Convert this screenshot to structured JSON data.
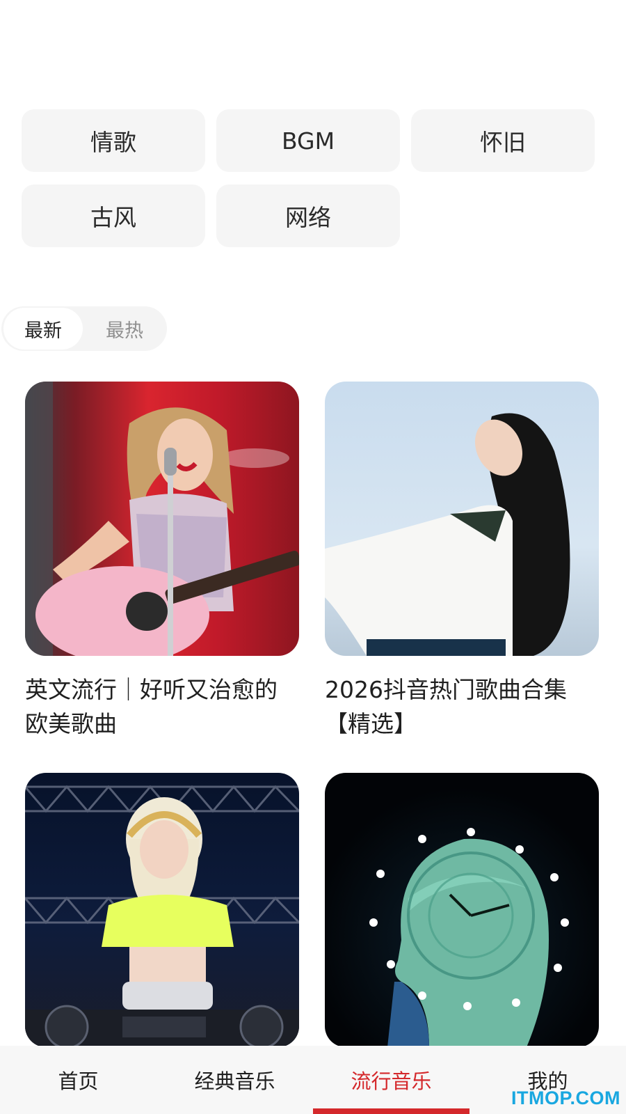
{
  "categories": [
    "情歌",
    "BGM",
    "怀旧",
    "古风",
    "网络"
  ],
  "sort": {
    "newest": "最新",
    "hottest": "最热",
    "selected": "最新"
  },
  "playlists": [
    {
      "title": "英文流行｜好听又治愈的\n欧美歌曲",
      "cover_icon": "guitar-singer-cover"
    },
    {
      "title": "2026抖音热门歌曲合集\n【精选】",
      "cover_icon": "girl-sky-cover"
    },
    {
      "title": "",
      "cover_icon": "dj-cover"
    },
    {
      "title": "",
      "cover_icon": "clock-girl-cover"
    }
  ],
  "tabs": [
    "首页",
    "经典音乐",
    "流行音乐",
    "我的"
  ],
  "active_tab": "流行音乐",
  "watermark": "ITMOP.COM",
  "colors": {
    "accent": "#d4282b",
    "chip_bg": "#f5f5f5",
    "watermark": "#19a7e0"
  }
}
